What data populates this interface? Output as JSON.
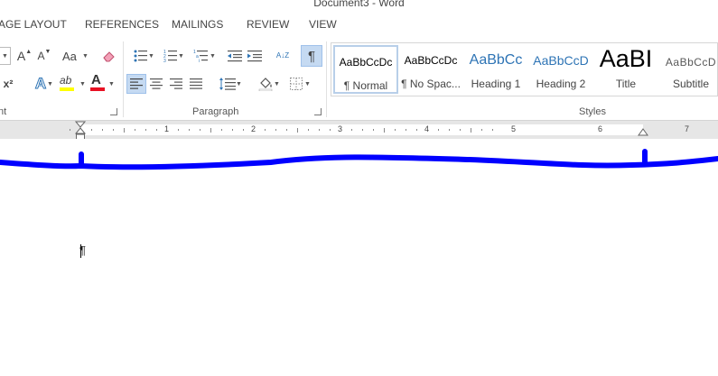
{
  "window": {
    "title": "Document3 - Word"
  },
  "tabs": [
    "AGE LAYOUT",
    "REFERENCES",
    "MAILINGS",
    "REVIEW",
    "VIEW"
  ],
  "ribbon": {
    "font_group": {
      "label": "nt",
      "change_case": "Aa",
      "grow_font": "A",
      "shrink_font": "A",
      "superscript": "x²",
      "text_effects": "A",
      "font_color": "A",
      "highlight": "ab",
      "colors": {
        "highlight": "#ffff00",
        "font_color": "#e81123"
      }
    },
    "paragraph_group": {
      "label": "Paragraph",
      "show_hide": "¶",
      "sort": "A↓Z"
    },
    "styles_group": {
      "label": "Styles",
      "items": [
        {
          "preview": "AaBbCcDc",
          "name": "¶ Normal",
          "color": "#000000",
          "selected": true
        },
        {
          "preview": "AaBbCcDc",
          "name": "¶ No Spac...",
          "color": "#000000",
          "selected": false
        },
        {
          "preview": "AaBbCc",
          "name": "Heading 1",
          "color": "#2e74b5",
          "selected": false
        },
        {
          "preview": "AaBbCcD",
          "name": "Heading 2",
          "color": "#2e74b5",
          "selected": false
        },
        {
          "preview": "AaBI",
          "name": "Title",
          "color": "#000000",
          "selected": false
        },
        {
          "preview": "AaBbCcD",
          "name": "Subtitle",
          "color": "#595959",
          "selected": false
        }
      ]
    },
    "accent_color": "#c5daf2"
  },
  "ruler": {
    "numbers": [
      "1",
      "2",
      "3",
      "4",
      "5",
      "6",
      "7"
    ]
  },
  "document": {
    "paragraph_mark": "¶",
    "ink_color": "#0000ff"
  }
}
